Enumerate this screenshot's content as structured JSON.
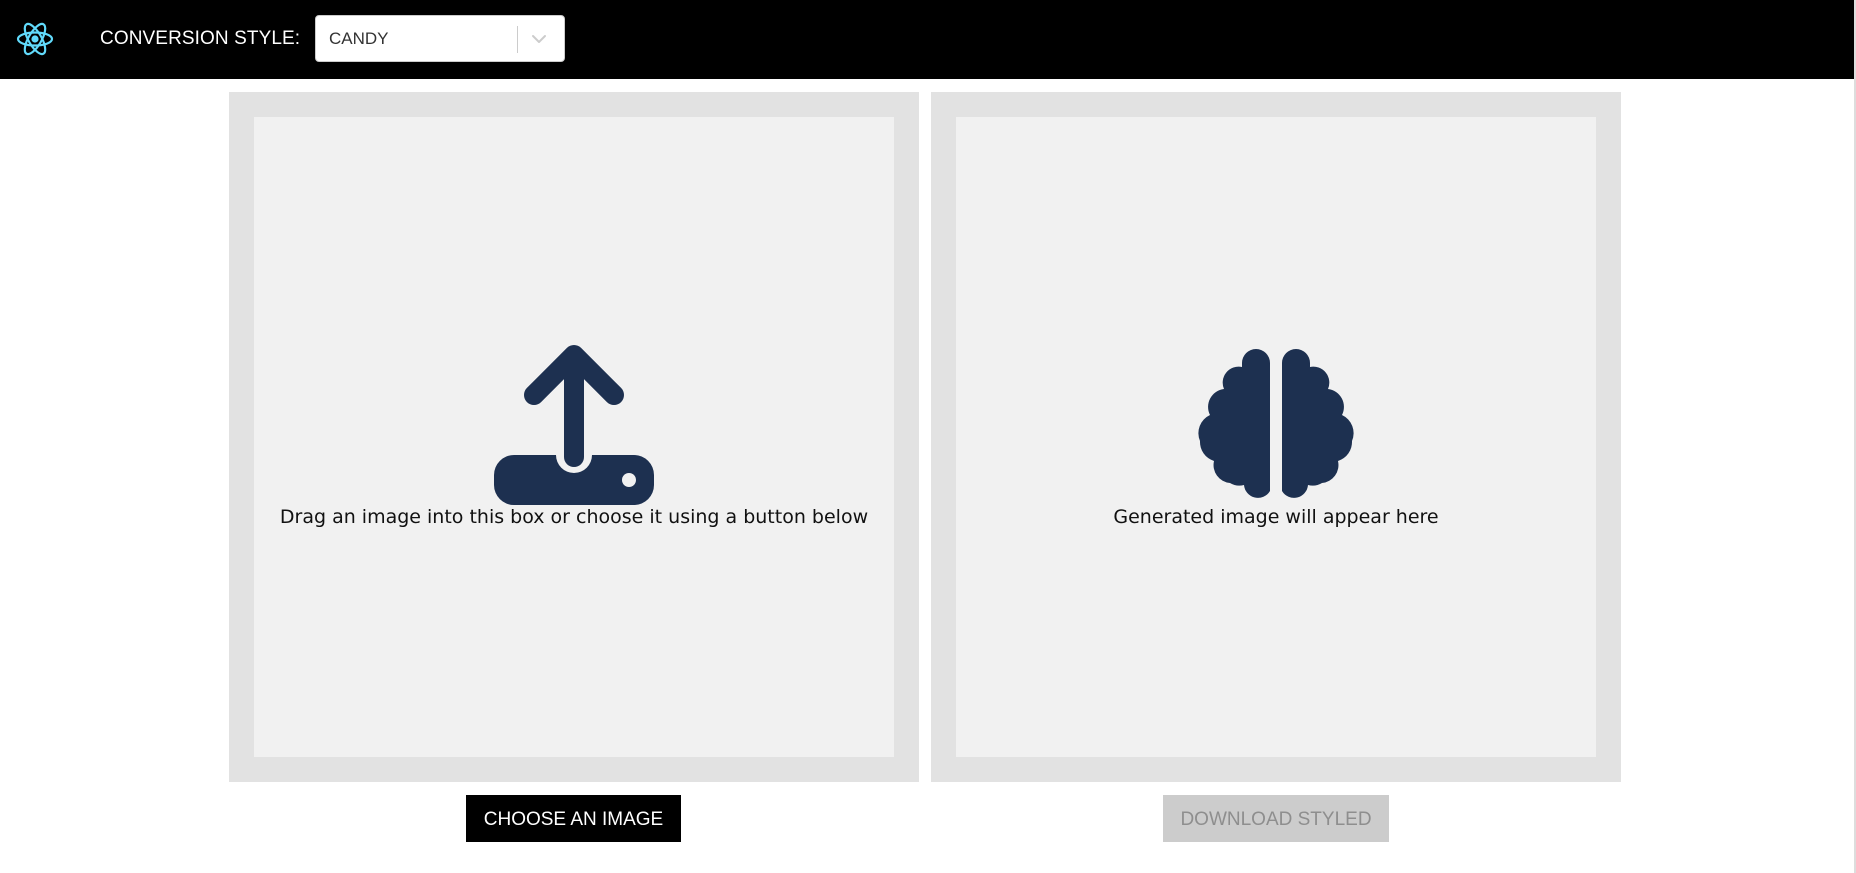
{
  "header": {
    "logo_icon": "react-atom-icon",
    "style_label": "CONVERSION STYLE:",
    "style_select": {
      "selected": "CANDY",
      "arrow_icon": "chevron-down-icon"
    }
  },
  "input_panel": {
    "icon": "upload-icon",
    "text": "Drag an image into this box or choose it using a button below"
  },
  "output_panel": {
    "icon": "brain-icon",
    "text": "Generated image will appear here"
  },
  "buttons": {
    "choose_label": "CHOOSE AN IMAGE",
    "download_label": "DOWNLOAD STYLED"
  },
  "colors": {
    "header_bg": "#000000",
    "icon_color": "#1d3050",
    "logo_color": "#61dafb",
    "panel_outer": "#e2e2e2",
    "panel_inner": "#f1f1f1",
    "button_disabled_bg": "#cccccc"
  }
}
